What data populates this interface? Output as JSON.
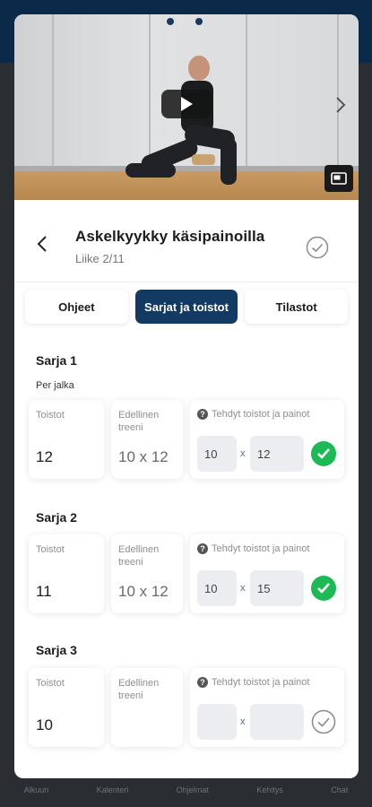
{
  "exercise": {
    "title": "Askelkyykky käsipainoilla",
    "subtitle": "Liike 2/11"
  },
  "tabs": [
    {
      "label": "Ohjeet",
      "active": false
    },
    {
      "label": "Sarjat ja toistot",
      "active": true
    },
    {
      "label": "Tilastot",
      "active": false
    }
  ],
  "labels": {
    "reps": "Toistot",
    "previous": "Edellinen\ntreeni",
    "done": "Tehdyt toistot ja painot",
    "times": "x"
  },
  "sets": [
    {
      "title": "Sarja 1",
      "note": "Per jalka",
      "reps": "12",
      "previous": "10 x 12",
      "done_reps": "10",
      "done_weight": "12",
      "completed": true
    },
    {
      "title": "Sarja 2",
      "note": "",
      "reps": "11",
      "previous": "10 x 12",
      "done_reps": "10",
      "done_weight": "15",
      "completed": true
    },
    {
      "title": "Sarja 3",
      "note": "",
      "reps": "10",
      "previous": "",
      "done_reps": "",
      "done_weight": "",
      "completed": false
    }
  ],
  "background_tabbar": [
    "Alkuun",
    "Kalenteri",
    "Ohjelmat",
    "Kehitys",
    "Chat"
  ],
  "colors": {
    "accent": "#133a63",
    "success": "#1db954",
    "input_bg": "#ebedf0"
  },
  "icons": {
    "back": "chevron-left-icon",
    "complete": "check-circle-icon",
    "play": "play-icon",
    "next": "chevron-right-icon",
    "pip": "picture-in-picture-icon",
    "help": "question-icon"
  }
}
